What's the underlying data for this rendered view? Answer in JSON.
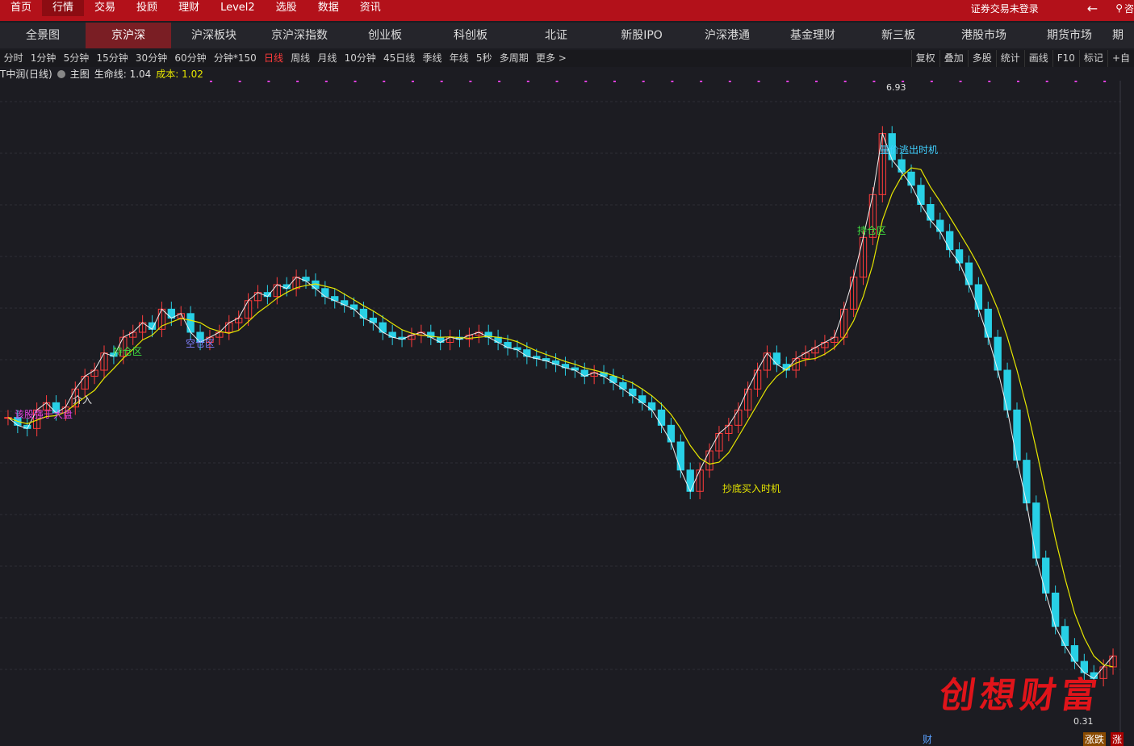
{
  "topbar": {
    "menu": [
      "首页",
      "行情",
      "交易",
      "投顾",
      "理财",
      "Level2",
      "选股",
      "数据",
      "资讯"
    ],
    "active": 1,
    "login_status": "证券交易未登录",
    "back_icon": "arrow-left-icon",
    "search_icon": "search-icon",
    "search_label": "咨"
  },
  "navbar": {
    "tabs": [
      "全景图",
      "京沪深",
      "沪深板块",
      "京沪深指数",
      "创业板",
      "科创板",
      "北证",
      "新股IPO",
      "沪深港通",
      "基金理财",
      "新三板",
      "港股市场",
      "期货市场",
      "期"
    ],
    "active": 1
  },
  "periodbar": {
    "periods": [
      "分时",
      "1分钟",
      "5分钟",
      "15分钟",
      "30分钟",
      "60分钟",
      "分钟*150",
      "日线",
      "周线",
      "月线",
      "10分钟",
      "45日线",
      "季线",
      "年线",
      "5秒",
      "多周期",
      "更多 >"
    ],
    "active": 7,
    "tools": [
      "复权",
      "叠加",
      "多股",
      "统计",
      "画线",
      "F10",
      "标记",
      "+自"
    ]
  },
  "infobar": {
    "stock": "T中润(日线)",
    "main_label": "主图",
    "life_line": "生命线: 1.04",
    "cost": "成本: 1.02"
  },
  "chart_data": {
    "type": "candlestick",
    "high_label": "6.93",
    "low_label": "0.31",
    "close_series": [
      1.25,
      1.2,
      1.18,
      1.3,
      1.35,
      1.28,
      1.32,
      1.45,
      1.55,
      1.6,
      1.75,
      1.72,
      1.9,
      1.95,
      2.05,
      1.98,
      2.2,
      2.1,
      2.15,
      1.95,
      1.85,
      1.9,
      1.95,
      2.05,
      2.1,
      2.3,
      2.4,
      2.35,
      2.5,
      2.45,
      2.6,
      2.55,
      2.45,
      2.35,
      2.3,
      2.25,
      2.2,
      2.1,
      2.05,
      1.95,
      1.9,
      1.88,
      1.92,
      1.95,
      1.9,
      1.85,
      1.9,
      1.88,
      1.92,
      1.95,
      1.9,
      1.85,
      1.8,
      1.78,
      1.72,
      1.7,
      1.68,
      1.65,
      1.62,
      1.6,
      1.55,
      1.58,
      1.55,
      1.5,
      1.45,
      1.4,
      1.35,
      1.3,
      1.2,
      1.1,
      0.95,
      0.85,
      0.95,
      1.05,
      1.15,
      1.2,
      1.3,
      1.45,
      1.6,
      1.75,
      1.65,
      1.6,
      1.7,
      1.75,
      1.8,
      1.85,
      1.9,
      2.2,
      2.6,
      3.2,
      4.0,
      5.5,
      4.8,
      4.5,
      4.2,
      3.8,
      3.5,
      3.3,
      3.0,
      2.8,
      2.5,
      2.2,
      1.9,
      1.6,
      1.3,
      1.0,
      0.8,
      0.6,
      0.5,
      0.42,
      0.38,
      0.35,
      0.33,
      0.32,
      0.34,
      0.36
    ],
    "annotations": [
      "该股强于大盘",
      "介入",
      "持仓区",
      "空仓区",
      "抄底买入时机",
      "量价逃出时机",
      "持仓区"
    ]
  },
  "watermark": "创想财富",
  "bottom_tags": {
    "left": "财",
    "mid": "涨跌",
    "right": "涨"
  }
}
